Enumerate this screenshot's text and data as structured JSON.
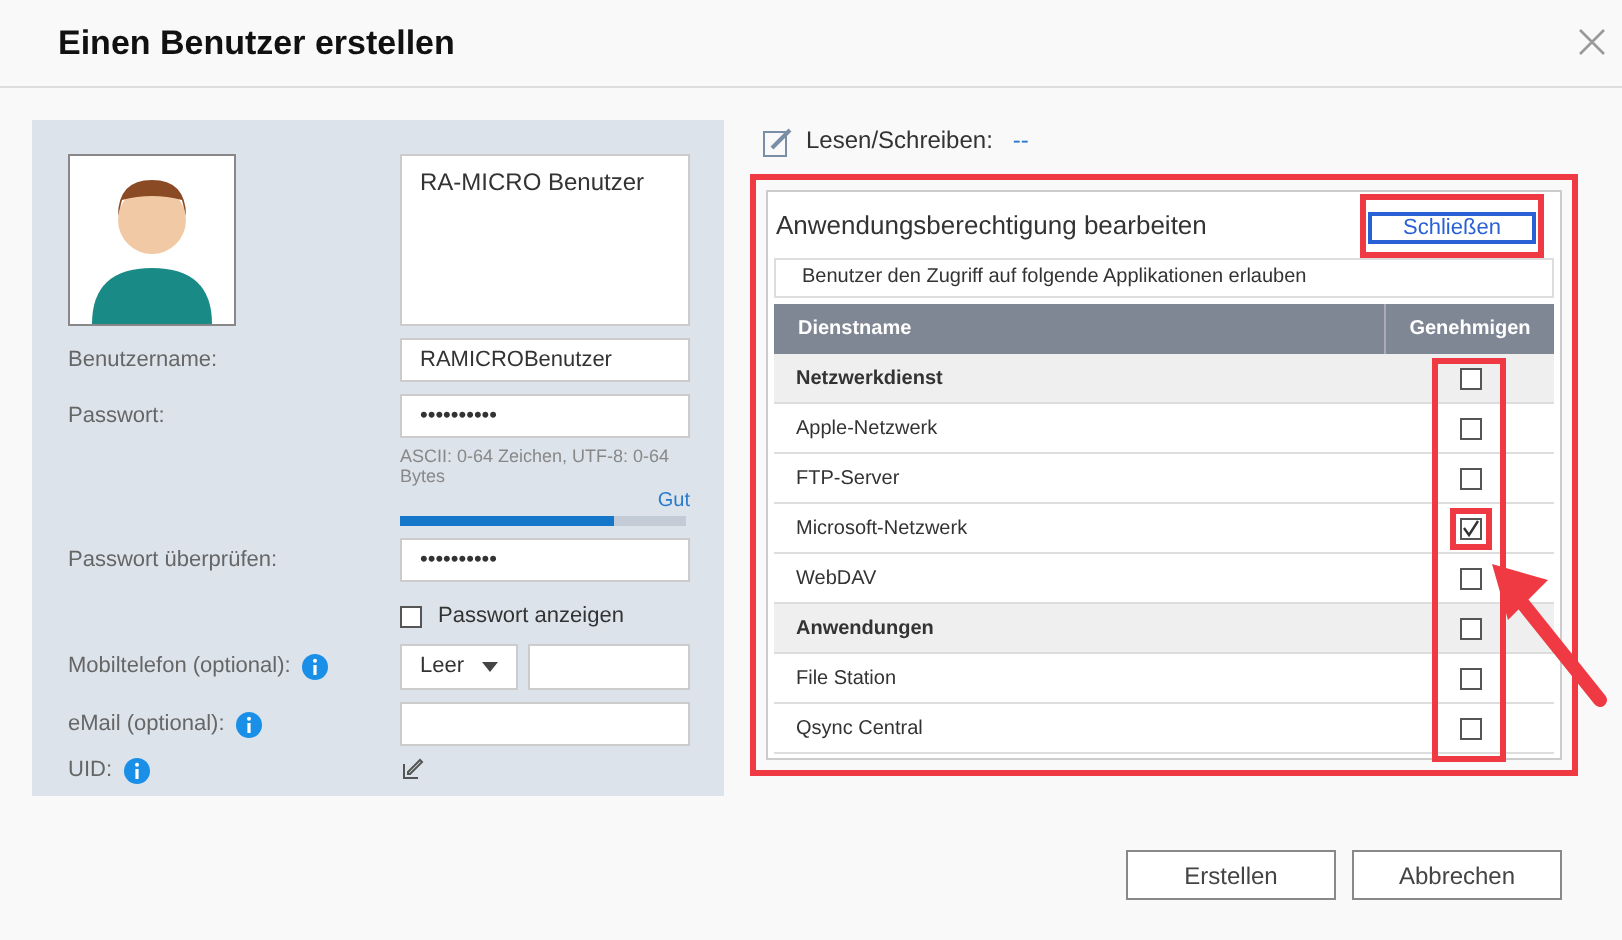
{
  "dialog": {
    "title": "Einen Benutzer erstellen"
  },
  "profile": {
    "description": "RA-MICRO Benutzer"
  },
  "fields": [
    {
      "kind": "text",
      "label": "Benutzername:",
      "value": "RAMICROBenutzer"
    },
    {
      "kind": "password",
      "label": "Passwort:",
      "value": "••••••••••"
    },
    {
      "kind": "strength",
      "hint": "ASCII: 0-64 Zeichen, UTF-8: 0-64 Bytes",
      "strength_label": "Gut",
      "level": 0.75
    },
    {
      "kind": "password",
      "label": "Passwort überprüfen:",
      "value": "••••••••••"
    },
    {
      "kind": "checkbox",
      "label": "Passwort anzeigen",
      "checked": false
    },
    {
      "kind": "phone",
      "label": "Mobiltelefon (optional):",
      "info": true,
      "dropdown": "Leer"
    },
    {
      "kind": "text",
      "label": "eMail (optional):",
      "info": true
    },
    {
      "kind": "edit",
      "label": "UID:",
      "info": true
    }
  ],
  "permissions": {
    "label": "Lesen/Schreiben:",
    "value": "--"
  },
  "app_permissions": {
    "title": "Anwendungsberechtigung bearbeiten",
    "close_button": "Schließen",
    "caption": "Benutzer den Zugriff auf folgende Applikationen erlauben",
    "columns": [
      "Dienstname",
      "Genehmigen"
    ],
    "rows": [
      {
        "kind": "group",
        "name": "Netzwerkdienst",
        "checked": false
      },
      {
        "kind": "item",
        "name": "Apple-Netzwerk",
        "checked": false
      },
      {
        "kind": "item",
        "name": "FTP-Server",
        "checked": false
      },
      {
        "kind": "item",
        "name": "Microsoft-Netzwerk",
        "checked": true
      },
      {
        "kind": "item",
        "name": "WebDAV",
        "checked": false
      },
      {
        "kind": "group",
        "name": "Anwendungen",
        "checked": false
      },
      {
        "kind": "item",
        "name": "File Station",
        "checked": false
      },
      {
        "kind": "item",
        "name": "Qsync Central",
        "checked": false
      }
    ]
  },
  "buttons": [
    "Erstellen",
    "Abbrechen"
  ]
}
